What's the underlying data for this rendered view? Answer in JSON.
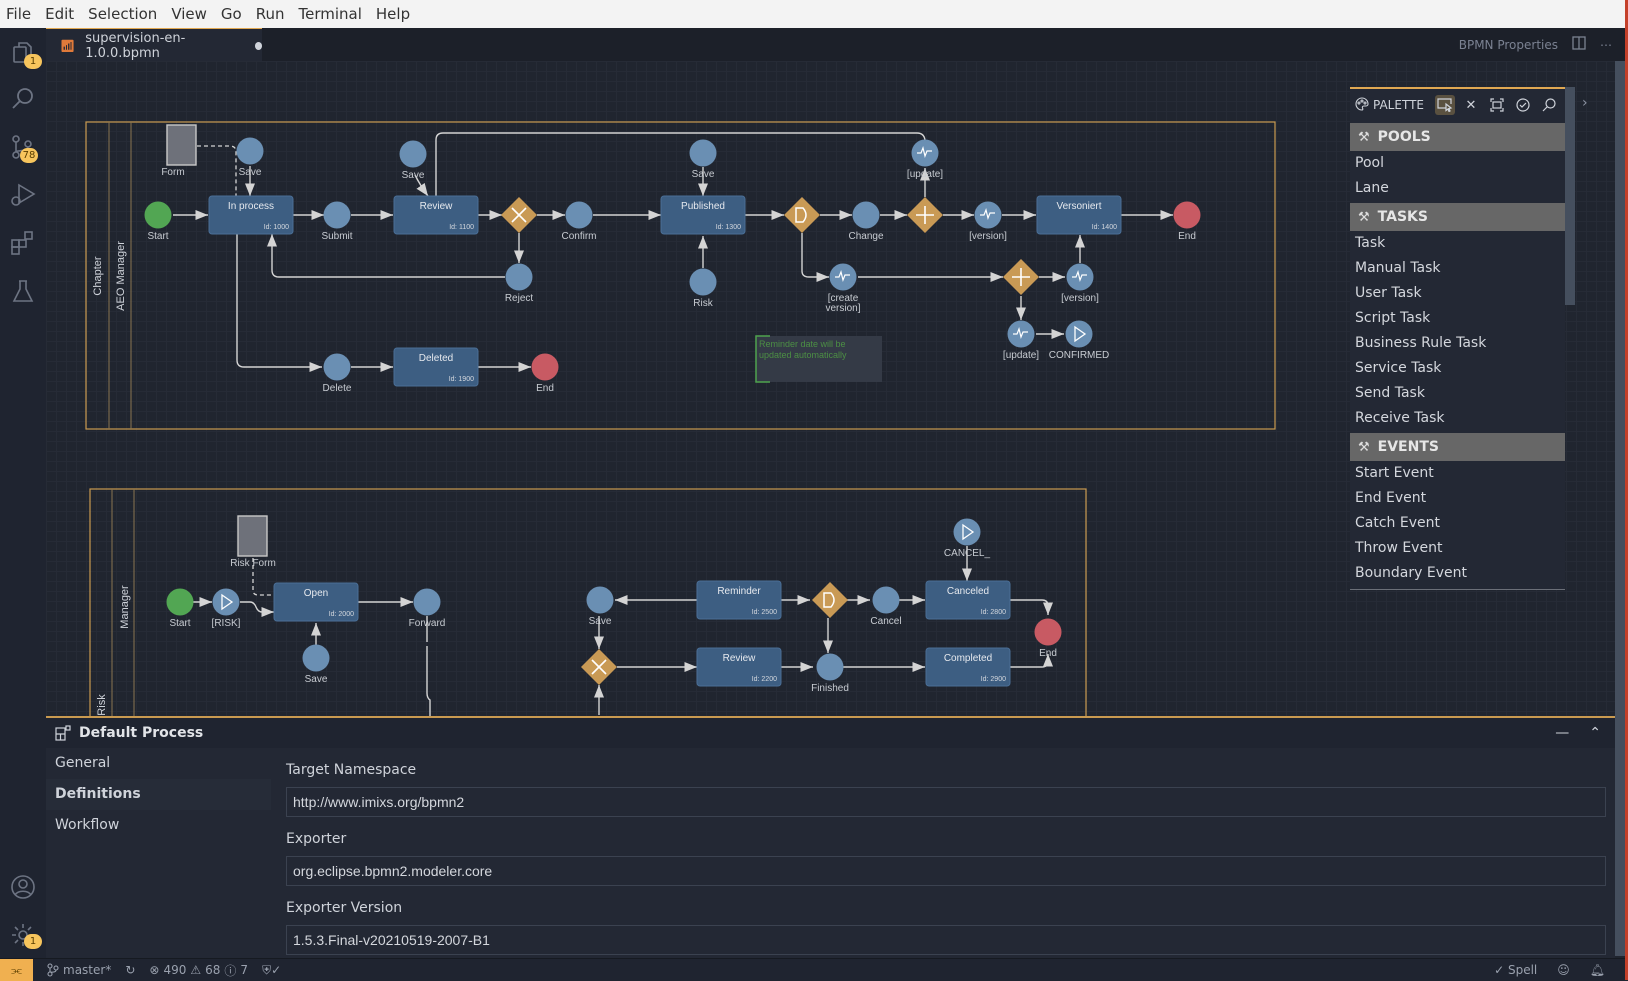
{
  "menu": [
    "File",
    "Edit",
    "Selection",
    "View",
    "Go",
    "Run",
    "Terminal",
    "Help"
  ],
  "activity_bar": {
    "items": [
      {
        "name": "explorer-icon",
        "badge": "1"
      },
      {
        "name": "search-icon",
        "badge": null
      },
      {
        "name": "source-control-icon",
        "badge": "78"
      },
      {
        "name": "run-debug-icon",
        "badge": null
      },
      {
        "name": "extensions-icon",
        "badge": null
      },
      {
        "name": "testing-icon",
        "badge": null
      }
    ],
    "bottom": [
      {
        "name": "account-icon",
        "badge": null
      },
      {
        "name": "settings-gear-icon",
        "badge": "1"
      }
    ]
  },
  "editor": {
    "tab": {
      "file": "supervision-en-1.0.0.bpmn",
      "modified": true
    },
    "actions": {
      "properties_label": "BPMN Properties"
    }
  },
  "diagram": {
    "pools": [
      {
        "pool": "Chapter",
        "lane": "AEO Manager"
      },
      {
        "pool": "Risk",
        "lane": "Manager"
      }
    ],
    "tasks": [
      {
        "id": "t1000",
        "name": "In process",
        "idlabel": "Id: 1000"
      },
      {
        "id": "t1100",
        "name": "Review",
        "idlabel": "Id: 1100"
      },
      {
        "id": "t1300",
        "name": "Published",
        "idlabel": "Id: 1300"
      },
      {
        "id": "t1400",
        "name": "Versoniert",
        "idlabel": "Id: 1400"
      },
      {
        "id": "t1900",
        "name": "Deleted",
        "idlabel": "Id: 1900"
      },
      {
        "id": "t2000",
        "name": "Open",
        "idlabel": "Id: 2000"
      },
      {
        "id": "t2500",
        "name": "Reminder",
        "idlabel": "Id: 2500"
      },
      {
        "id": "t2200",
        "name": "Review",
        "idlabel": "Id: 2200"
      },
      {
        "id": "t2800",
        "name": "Canceled",
        "idlabel": "Id: 2800"
      },
      {
        "id": "t2900",
        "name": "Completed",
        "idlabel": "Id: 2900"
      }
    ],
    "events": {
      "start1": "Start",
      "save1": "Save",
      "submit": "Submit",
      "save2": "Save",
      "reject": "Reject",
      "confirm": "Confirm",
      "save3": "Save",
      "risk": "Risk",
      "change": "Change",
      "update1": "[update]",
      "version1": "[version]",
      "end1": "End",
      "createversion1": "[create",
      "createversion2": "version]",
      "version2": "[version]",
      "update2": "[update]",
      "confirmed": "CONFIRMED",
      "delete": "Delete",
      "end2": "End",
      "start2": "Start",
      "risk2": "[RISK]",
      "save4": "Save",
      "forward": "Forward",
      "save5": "Save",
      "cancel": "Cancel",
      "cancel_": "CANCEL_",
      "finished": "Finished",
      "end3": "End"
    },
    "data_objects": {
      "form": "Form",
      "riskform": "Risk Form"
    },
    "annotation": {
      "line1": "Reminder date will be",
      "line2": "updated automatically"
    }
  },
  "palette": {
    "title": "PALETTE",
    "groups": [
      {
        "label": "POOLS",
        "items": [
          "Pool",
          "Lane"
        ]
      },
      {
        "label": "TASKS",
        "items": [
          "Task",
          "Manual Task",
          "User Task",
          "Script Task",
          "Business Rule Task",
          "Service Task",
          "Send Task",
          "Receive Task"
        ]
      },
      {
        "label": "EVENTS",
        "items": [
          "Start Event",
          "End Event",
          "Catch Event",
          "Throw Event",
          "Boundary Event"
        ]
      }
    ]
  },
  "properties": {
    "title": "Default Process",
    "nav": [
      "General",
      "Definitions",
      "Workflow"
    ],
    "active_nav": "Definitions",
    "fields": [
      {
        "label": "Target Namespace",
        "value": "http://www.imixs.org/bpmn2"
      },
      {
        "label": "Exporter",
        "value": "org.eclipse.bpmn2.modeler.core"
      },
      {
        "label": "Exporter Version",
        "value": "1.5.3.Final-v20210519-2007-B1"
      }
    ]
  },
  "status_bar": {
    "branch": "master*",
    "errors": "490",
    "warnings": "68",
    "infos": "7",
    "spell": "Spell"
  },
  "colors": {
    "task": "#3d5e82",
    "event": "#6a8fb3",
    "start": "#52a653",
    "end": "#c85a63",
    "gateway": "#c99a55",
    "accent": "#e0a852"
  }
}
